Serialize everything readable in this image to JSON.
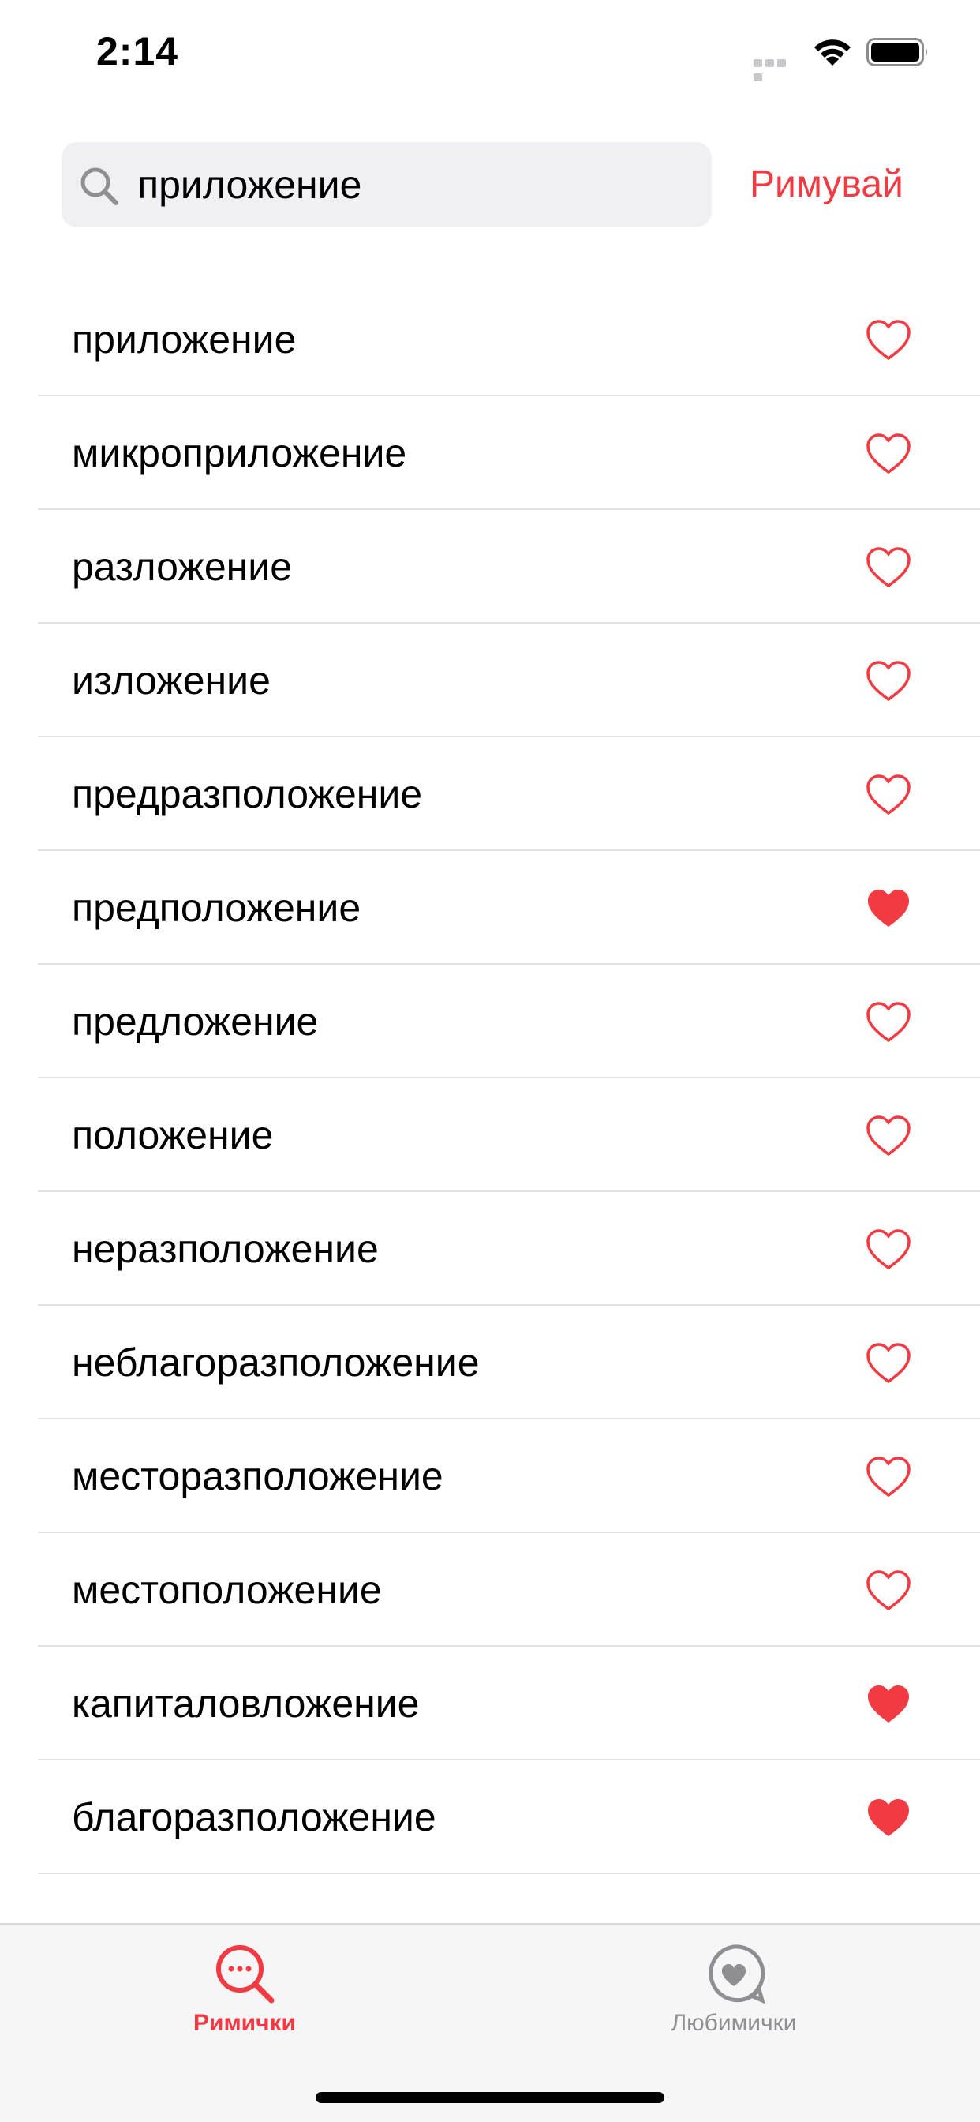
{
  "status_bar": {
    "time": "2:14"
  },
  "search": {
    "value": "приложение",
    "action_label": "Римувай"
  },
  "colors": {
    "accent": "#f23a43",
    "inactive": "#8e8e93"
  },
  "words": [
    {
      "text": "приложение",
      "favorite": false
    },
    {
      "text": "микроприложение",
      "favorite": false
    },
    {
      "text": "разложение",
      "favorite": false
    },
    {
      "text": "изложение",
      "favorite": false
    },
    {
      "text": "предразположение",
      "favorite": false
    },
    {
      "text": "предположение",
      "favorite": true
    },
    {
      "text": "предложение",
      "favorite": false
    },
    {
      "text": "положение",
      "favorite": false
    },
    {
      "text": "неразположение",
      "favorite": false
    },
    {
      "text": "неблагоразположение",
      "favorite": false
    },
    {
      "text": "месторазположение",
      "favorite": false
    },
    {
      "text": "местоположение",
      "favorite": false
    },
    {
      "text": "капиталовложение",
      "favorite": true
    },
    {
      "text": "благоразположение",
      "favorite": true
    }
  ],
  "tab_bar": {
    "tabs": [
      {
        "label": "Римички",
        "icon": "magnifier-chat-icon",
        "active": true
      },
      {
        "label": "Любимички",
        "icon": "heart-bubble-icon",
        "active": false
      }
    ]
  }
}
